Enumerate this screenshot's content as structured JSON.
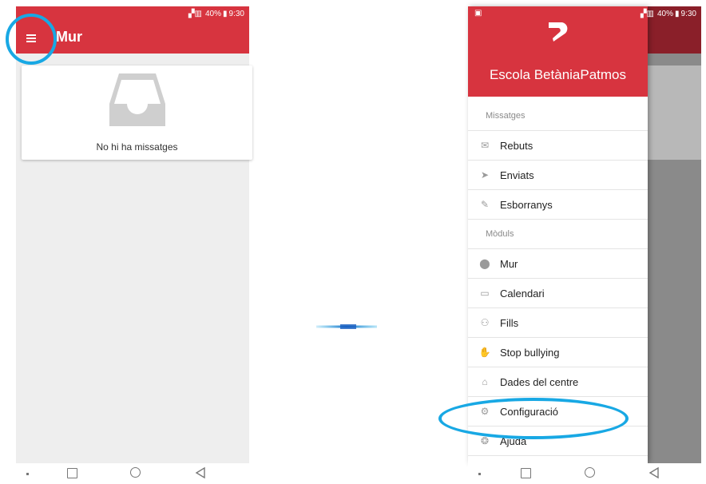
{
  "status_bar": {
    "battery": "40%",
    "time": "9:30"
  },
  "left_screen": {
    "title": "Mur",
    "empty_message": "No hi ha missatges"
  },
  "right_screen": {
    "school_name": "Escola BetàniaPatmos",
    "sections": [
      {
        "label": "Missatges",
        "items": [
          {
            "label": "Rebuts",
            "icon": "envelope-icon"
          },
          {
            "label": "Enviats",
            "icon": "send-icon"
          },
          {
            "label": "Esborranys",
            "icon": "draft-icon"
          }
        ]
      },
      {
        "label": "Mòduls",
        "items": [
          {
            "label": "Mur",
            "icon": "location-pin-icon"
          },
          {
            "label": "Calendari",
            "icon": "calendar-icon"
          },
          {
            "label": "Fills",
            "icon": "family-icon"
          },
          {
            "label": "Stop bullying",
            "icon": "hand-stop-icon"
          },
          {
            "label": "Dades del centre",
            "icon": "home-icon"
          },
          {
            "label": "Configuració",
            "icon": "gear-icon"
          },
          {
            "label": "Ajuda",
            "icon": "help-icon"
          }
        ]
      }
    ]
  },
  "colors": {
    "accent": "#d7343f",
    "highlight": "#18a8e4"
  }
}
